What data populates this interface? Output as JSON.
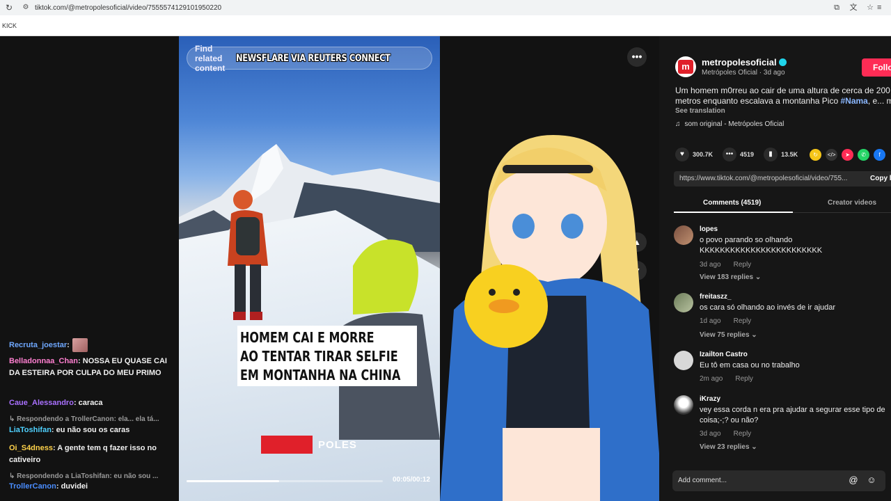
{
  "browser": {
    "url": "tiktok.com/@metropolesoficial/video/7555574129101950220",
    "bookmark": "KICK"
  },
  "chat": {
    "messages": [
      {
        "user": "Recruta_joestar",
        "text": "",
        "color": "#6fa8ff"
      },
      {
        "user": "Belladonnaa_Chan",
        "text": "NOSSA EU QUASE CAI DA ESTEIRA POR CULPA DO MEU PRIMO",
        "color": "#ff7fd0"
      },
      {
        "user": "Caue_Alessandro",
        "text": "caraca",
        "color": "#a970ff"
      },
      {
        "reply": "Respondendo a TrollerCanon: ela... ela tá..."
      },
      {
        "user": "LiaToshifan",
        "text": "eu não sou os caras",
        "color": "#4fd1ff"
      },
      {
        "user": "Oi_S4dness",
        "text": "A gente tem q fazer isso no cativeiro",
        "color": "#ffd24a"
      },
      {
        "reply": "Respondendo a LiaToshifan: eu não sou ..."
      },
      {
        "user": "TrollerCanon",
        "text": "duvidei",
        "color": "#4a8dff"
      }
    ]
  },
  "video": {
    "find_related": "Find related content",
    "credit": "NEWSFLARE VIA REUTERS CONNECT",
    "caption": [
      "HOMEM CAI E MORRE",
      "AO TENTAR TIRAR SELFIE",
      "EM MONTANHA NA CHINA"
    ],
    "watermark": "POLES",
    "time": "00:05/00:12",
    "progress": 0.47
  },
  "post": {
    "username": "metropolesoficial",
    "display_name": "Metrópoles Oficial · 3d ago",
    "follow": "Follo",
    "description_pre": "Um homem m0rreu ao cair de uma altura de cerca de 200 metros enquanto escalava a montanha Pico ",
    "hashtag": "#Nama",
    "description_post": ", e...  m",
    "see_translation": "See translation",
    "music": "som original - Metrópoles Oficial",
    "likes": "300.7K",
    "comments": "4519",
    "saves": "13.5K",
    "link": "https://www.tiktok.com/@metropolesoficial/video/755...",
    "copy": "Copy l"
  },
  "tabs": {
    "comments": "Comments (4519)",
    "creator": "Creator videos"
  },
  "comments": [
    {
      "user": "lopes",
      "text": "o povo parando so olhando KKKKKKKKKKKKKKKKKKKKKKKK",
      "time": "3d ago",
      "reply": "Reply",
      "replies": "View 183 replies ⌄"
    },
    {
      "user": "freitaszz_",
      "text": "os cara só olhando ao invés de ir ajudar",
      "time": "1d ago",
      "reply": "Reply",
      "replies": "View 75 replies ⌄"
    },
    {
      "user": "Izailton Castro",
      "text": "Eu tô em casa ou no trabalho",
      "time": "2m ago",
      "reply": "Reply",
      "replies": ""
    },
    {
      "user": "iKrazy",
      "text": "vey essa corda n era pra ajudar a segurar esse tipo de coisa;-;? ou não?",
      "time": "3d ago",
      "reply": "Reply",
      "replies": "View 23 replies ⌄"
    }
  ],
  "add_comment": "Add comment...",
  "colors": {
    "accent": "#fe2c55",
    "brand_red": "#e0202a"
  }
}
